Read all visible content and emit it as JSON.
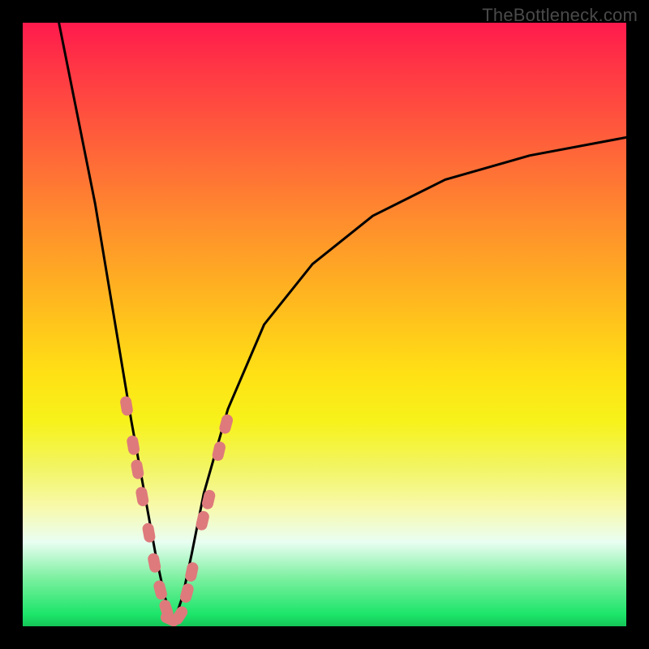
{
  "watermark": "TheBottleneck.com",
  "chart_data": {
    "type": "line",
    "title": "",
    "xlabel": "",
    "ylabel": "",
    "xlim": [
      0,
      100
    ],
    "ylim": [
      0,
      100
    ],
    "grid": false,
    "legend": false,
    "curve": {
      "name": "bottleneck-curve",
      "note": "Black V-shaped curve; minimum near x≈25 where bottleneck≈0; rises steeply to both sides.",
      "x": [
        6,
        8,
        10,
        12,
        14,
        16,
        18,
        20,
        22,
        23.5,
        25,
        26.5,
        28,
        30,
        34,
        40,
        48,
        58,
        70,
        84,
        100
      ],
      "y": [
        100,
        90,
        80,
        70,
        58,
        46,
        34,
        23,
        12,
        5,
        0.5,
        5,
        12,
        22,
        36,
        50,
        60,
        68,
        74,
        78,
        81
      ]
    },
    "highlight_points": {
      "name": "salmon-dots",
      "note": "Pink markers clustered around the trough of the curve",
      "x": [
        17.2,
        18.3,
        19.0,
        19.8,
        20.9,
        21.8,
        22.8,
        23.8,
        24.4,
        26.0,
        27.2,
        28.0,
        29.8,
        30.8,
        32.5,
        33.7
      ],
      "y": [
        36.5,
        30.0,
        26.0,
        21.5,
        15.5,
        10.5,
        6.0,
        2.8,
        1.2,
        1.8,
        5.5,
        9.0,
        17.5,
        21.0,
        29.0,
        33.5
      ]
    }
  }
}
